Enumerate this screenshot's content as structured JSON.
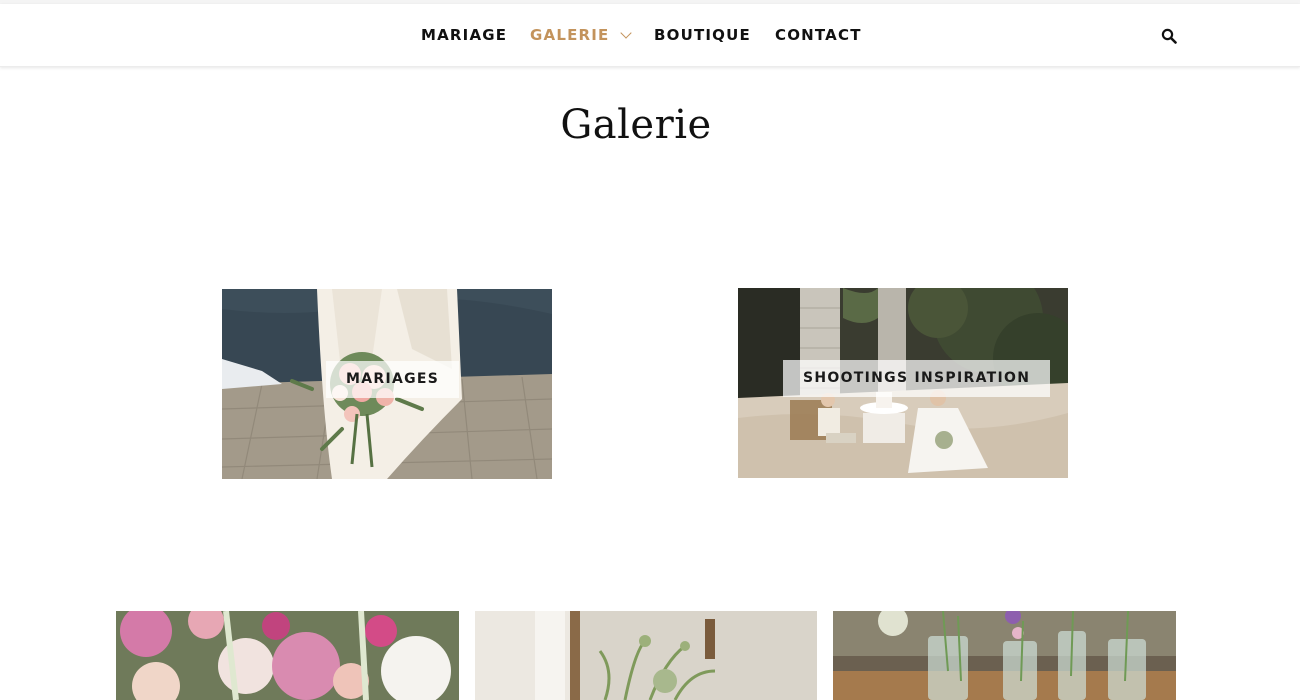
{
  "nav": {
    "items": [
      {
        "label": "MARIAGE",
        "active": false
      },
      {
        "label": "GALERIE",
        "active": true
      },
      {
        "label": "BOUTIQUE",
        "active": false
      },
      {
        "label": "CONTACT",
        "active": false
      }
    ],
    "search_icon": "search-icon",
    "accent_color": "#c3935c"
  },
  "page": {
    "title": "Galerie"
  },
  "galleries": [
    {
      "label": "MARIAGES"
    },
    {
      "label": "SHOOTINGS INSPIRATION"
    }
  ]
}
